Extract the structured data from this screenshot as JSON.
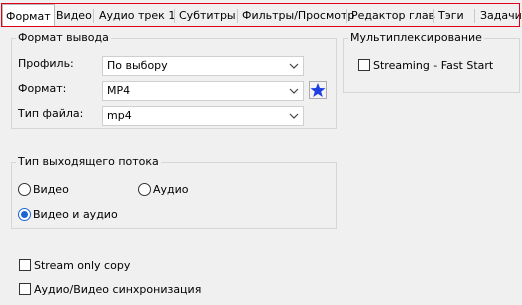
{
  "tabs": [
    {
      "label": "Формат",
      "active": true
    },
    {
      "label": "Видео"
    },
    {
      "label": "Аудио трек 1"
    },
    {
      "label": "Субтитры"
    },
    {
      "label": "Фильтры/Просмотр"
    },
    {
      "label": "Редактор глав"
    },
    {
      "label": "Тэги"
    },
    {
      "label": "Задачи"
    }
  ],
  "output_format": {
    "title": "Формат вывода",
    "profile_label": "Профиль:",
    "profile_value": "По выбору",
    "format_label": "Формат:",
    "format_value": "MP4",
    "filetype_label": "Тип файла:",
    "filetype_value": "mp4",
    "favorite_icon": "star-icon",
    "favorite_color": "#1f3fe0"
  },
  "muxing": {
    "title": "Мультиплексирование",
    "streaming_label": "Streaming - Fast Start",
    "streaming_checked": false
  },
  "stream_type": {
    "title": "Тип выходящего потока",
    "video_label": "Видео",
    "audio_label": "Аудио",
    "video_audio_label": "Видео и аудио",
    "selected": "Видео и аудио"
  },
  "options": {
    "stream_only_copy_label": "Stream only copy",
    "stream_only_copy_checked": false,
    "av_sync_label": "Аудио/Видео синхронизация",
    "av_sync_checked": false
  }
}
